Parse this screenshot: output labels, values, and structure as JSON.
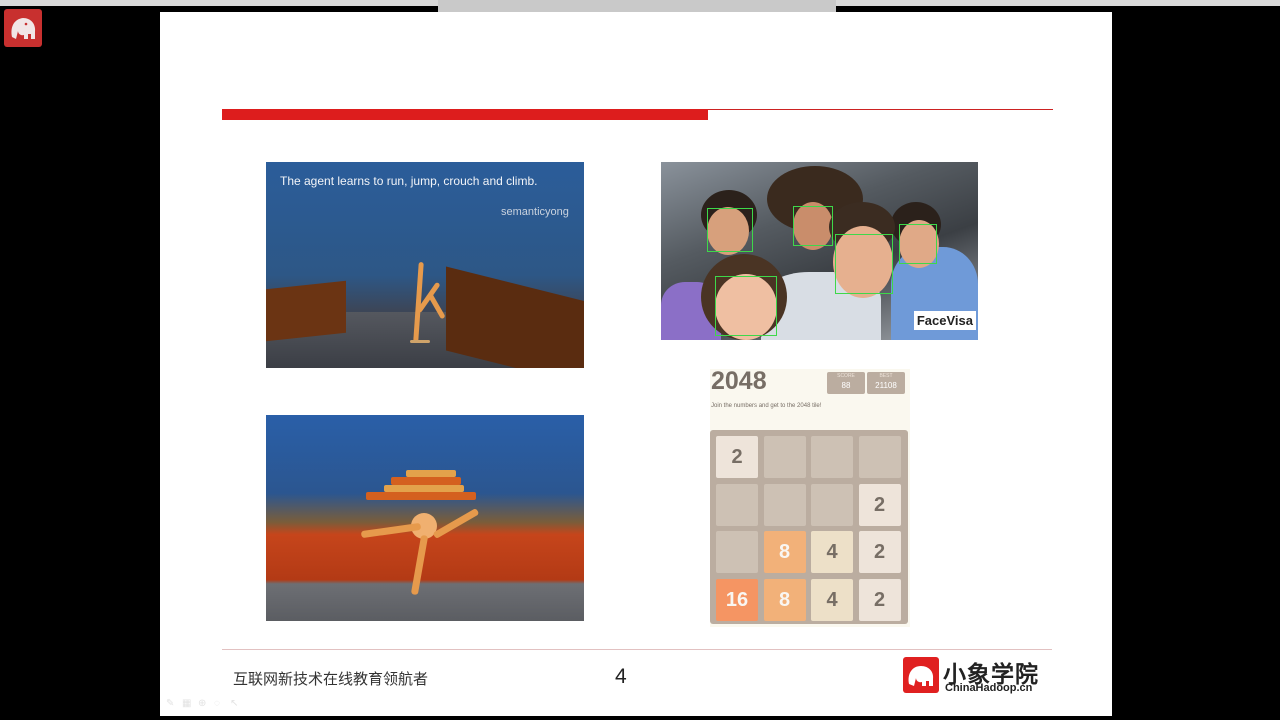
{
  "presenter": {
    "logo_icon": "elephant-logo-icon"
  },
  "slide": {
    "page_number": "4",
    "footer_slogan": "互联网新技术在线教育领航者",
    "accent_color": "#dd1d1d",
    "brand": {
      "name": "小象学院",
      "url": "ChinaHadoop.cn",
      "logo_icon": "elephant-logo-icon"
    },
    "images": {
      "agent_run": {
        "caption": "The agent learns to run, jump, crouch and climb.",
        "watermark": "semanticyong"
      },
      "face_detection": {
        "label": "FaceVisa"
      },
      "game_2048": {
        "title": "2048",
        "score_label": "SCORE",
        "score_value": "88",
        "best_label": "BEST",
        "best_value": "21108",
        "intro": "Join the numbers and get to the 2048 tile!",
        "grid": [
          [
            "2",
            "",
            "",
            ""
          ],
          [
            "",
            "",
            "",
            "2"
          ],
          [
            "",
            "8",
            "4",
            "2"
          ],
          [
            "16",
            "8",
            "4",
            "2"
          ]
        ]
      }
    }
  },
  "toolbar": {
    "icons": [
      "pen-icon",
      "grid-icon",
      "zoom-icon",
      "pointer-icon",
      "cursor-icon"
    ]
  }
}
